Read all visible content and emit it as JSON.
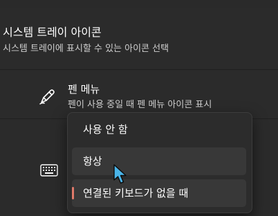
{
  "tray_section": {
    "title": "시스템 트레이 아이콘",
    "description": "시스템 트레이에 표시할 수 있는 아이콘 선택"
  },
  "pen_menu": {
    "icon": "pen-icon",
    "title": "펜 메뉴",
    "description": "펜이 사용 중일 때 펜 메뉴 아이콘 표시"
  },
  "touch_keyboard": {
    "icon": "keyboard-icon"
  },
  "dropdown": {
    "options": [
      {
        "label": "사용 안 함"
      },
      {
        "label": "항상"
      },
      {
        "label": "연결된 키보드가 없을 때"
      }
    ],
    "selected_index": 2,
    "hovered_index": 1
  },
  "colors": {
    "accent": "#e07a6a",
    "cursor": "#4ab4e8"
  }
}
